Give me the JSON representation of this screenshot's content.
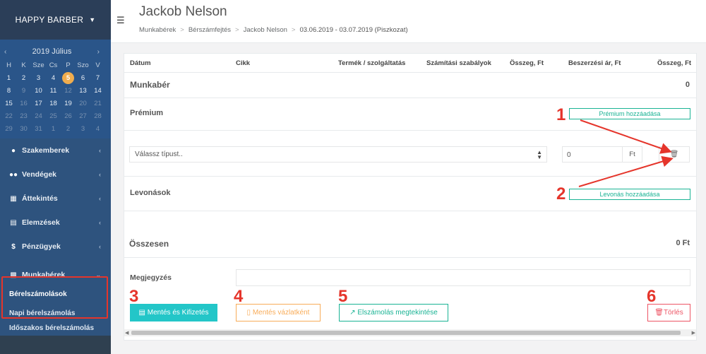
{
  "sidebar": {
    "brand": "HAPPY BARBER",
    "calendar": {
      "title": "2019 Július",
      "weekdays": [
        "H",
        "K",
        "Sze",
        "Cs",
        "P",
        "Szo",
        "V"
      ],
      "weeks": [
        [
          "1",
          "2",
          "3",
          "4",
          "5",
          "6",
          "7"
        ],
        [
          "8",
          "9",
          "10",
          "11",
          "12",
          "13",
          "14"
        ],
        [
          "15",
          "16",
          "17",
          "18",
          "19",
          "20",
          "21"
        ],
        [
          "22",
          "23",
          "24",
          "25",
          "26",
          "27",
          "28"
        ],
        [
          "29",
          "30",
          "31",
          "1",
          "2",
          "3",
          "4"
        ]
      ],
      "selected_day": "5"
    },
    "items": [
      {
        "label": "Szakemberek"
      },
      {
        "label": "Vendégek"
      },
      {
        "label": "Áttekintés"
      },
      {
        "label": "Elemzések"
      },
      {
        "label": "Pénzügyek"
      },
      {
        "label": "Munkabérek"
      }
    ],
    "subitems": [
      {
        "label": "Bérelszámolások"
      },
      {
        "label": "Napi bérelszámolás"
      },
      {
        "label": "Időszakos bérelszámolás"
      }
    ]
  },
  "header": {
    "title": "Jackob Nelson",
    "breadcrumb": [
      "Munkabérek",
      "Bérszámfejtés",
      "Jackob Nelson",
      "03.06.2019 - 03.07.2019 (Piszkozat)"
    ]
  },
  "table": {
    "columns": [
      "Dátum",
      "Cikk",
      "Termék / szolgáltatás",
      "Számítási szabályok",
      "Összeg, Ft",
      "Beszerzési ár, Ft",
      "Összeg, Ft"
    ]
  },
  "sections": {
    "munkaber_label": "Munkabér",
    "munkaber_value": "0",
    "premium_label": "Prémium",
    "premium_add": "Prémium hozzáadása",
    "type_select_placeholder": "Válassz típust..",
    "amount_value": "0",
    "amount_unit": "Ft",
    "levonasok_label": "Levonások",
    "levonas_add": "Levonás hozzáadása",
    "total_label": "Összesen",
    "total_value": "0 Ft",
    "note_label": "Megjegyzés"
  },
  "actions": {
    "save_pay": "Mentés és Kifizetés",
    "save_draft": "Mentés vázlatként",
    "view_settlement": "Elszámolás megtekintése",
    "delete": "Törlés"
  },
  "annotations": [
    "1",
    "2",
    "3",
    "4",
    "5",
    "6"
  ],
  "colors": {
    "sidebar_bg": "#2f4050",
    "calendar_bg": "#2a5589",
    "today_badge": "#f0ad4e",
    "annotation_red": "#e5352b",
    "info": "#23c6c8",
    "warning": "#f8ac59",
    "primary_teal": "#1ab394",
    "danger": "#ed5565"
  }
}
